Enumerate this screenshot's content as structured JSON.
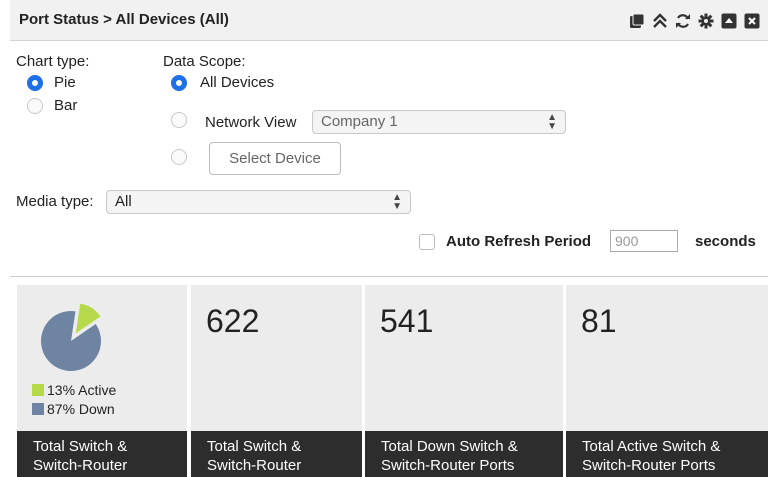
{
  "header": {
    "title": "Port Status > All Devices (All)"
  },
  "chart_type": {
    "label": "Chart type:",
    "options": [
      "Pie",
      "Bar"
    ],
    "selected": "Pie"
  },
  "data_scope": {
    "label": "Data Scope:",
    "all_devices": "All Devices",
    "network_view_label": "Network View",
    "network_view_value": "Company 1",
    "select_device": "Select Device",
    "selected": "All Devices"
  },
  "media_type": {
    "label": "Media type:",
    "value": "All"
  },
  "auto_refresh": {
    "label": "Auto Refresh Period",
    "value": "900",
    "unit": "seconds",
    "checked": false
  },
  "tiles": [
    {
      "footer_line1": "Total Switch &",
      "footer_line2": "Switch-Router"
    },
    {
      "number": "622",
      "footer_line1": "Total Switch &",
      "footer_line2": "Switch-Router"
    },
    {
      "number": "541",
      "footer_line1": "Total Down Switch &",
      "footer_line2": "Switch-Router Ports"
    },
    {
      "number": "81",
      "footer_line1": "Total Active Switch &",
      "footer_line2": "Switch-Router Ports"
    }
  ],
  "chart_data": {
    "type": "pie",
    "slices": [
      {
        "label": "13% Active",
        "value": 13,
        "color": "#b5d94a"
      },
      {
        "label": "87% Down",
        "value": 87,
        "color": "#6f83a3"
      }
    ]
  },
  "colors": {
    "active": "#b5d94a",
    "down": "#6f83a3",
    "radio_on": "#1e6fe8",
    "footer_bg": "#2d2d2d"
  },
  "icons": [
    "save-icon",
    "collapse-icon",
    "refresh-icon",
    "gear-icon",
    "minimize-icon",
    "close-icon"
  ]
}
